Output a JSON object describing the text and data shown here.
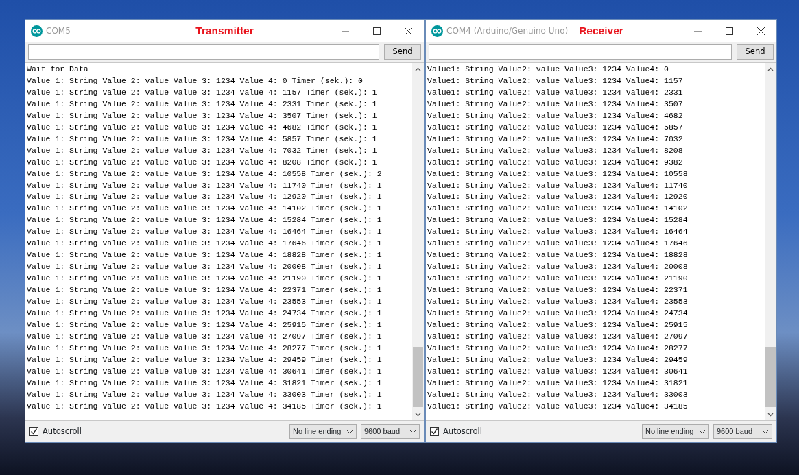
{
  "windows": [
    {
      "title": "COM5",
      "caption": "Transmitter",
      "send_label": "Send",
      "autoscroll": {
        "label": "Autoscroll",
        "checked": true
      },
      "line_ending": "No line ending",
      "baud": "9600 baud",
      "lines": [
        "Wait for Data",
        "Value 1: String Value 2: value Value 3: 1234 Value 4: 0 Timer (sek.): 0",
        "Value 1: String Value 2: value Value 3: 1234 Value 4: 1157 Timer (sek.): 1",
        "Value 1: String Value 2: value Value 3: 1234 Value 4: 2331 Timer (sek.): 1",
        "Value 1: String Value 2: value Value 3: 1234 Value 4: 3507 Timer (sek.): 1",
        "Value 1: String Value 2: value Value 3: 1234 Value 4: 4682 Timer (sek.): 1",
        "Value 1: String Value 2: value Value 3: 1234 Value 4: 5857 Timer (sek.): 1",
        "Value 1: String Value 2: value Value 3: 1234 Value 4: 7032 Timer (sek.): 1",
        "Value 1: String Value 2: value Value 3: 1234 Value 4: 8208 Timer (sek.): 1",
        "Value 1: String Value 2: value Value 3: 1234 Value 4: 10558 Timer (sek.): 2",
        "Value 1: String Value 2: value Value 3: 1234 Value 4: 11740 Timer (sek.): 1",
        "Value 1: String Value 2: value Value 3: 1234 Value 4: 12920 Timer (sek.): 1",
        "Value 1: String Value 2: value Value 3: 1234 Value 4: 14102 Timer (sek.): 1",
        "Value 1: String Value 2: value Value 3: 1234 Value 4: 15284 Timer (sek.): 1",
        "Value 1: String Value 2: value Value 3: 1234 Value 4: 16464 Timer (sek.): 1",
        "Value 1: String Value 2: value Value 3: 1234 Value 4: 17646 Timer (sek.): 1",
        "Value 1: String Value 2: value Value 3: 1234 Value 4: 18828 Timer (sek.): 1",
        "Value 1: String Value 2: value Value 3: 1234 Value 4: 20008 Timer (sek.): 1",
        "Value 1: String Value 2: value Value 3: 1234 Value 4: 21190 Timer (sek.): 1",
        "Value 1: String Value 2: value Value 3: 1234 Value 4: 22371 Timer (sek.): 1",
        "Value 1: String Value 2: value Value 3: 1234 Value 4: 23553 Timer (sek.): 1",
        "Value 1: String Value 2: value Value 3: 1234 Value 4: 24734 Timer (sek.): 1",
        "Value 1: String Value 2: value Value 3: 1234 Value 4: 25915 Timer (sek.): 1",
        "Value 1: String Value 2: value Value 3: 1234 Value 4: 27097 Timer (sek.): 1",
        "Value 1: String Value 2: value Value 3: 1234 Value 4: 28277 Timer (sek.): 1",
        "Value 1: String Value 2: value Value 3: 1234 Value 4: 29459 Timer (sek.): 1",
        "Value 1: String Value 2: value Value 3: 1234 Value 4: 30641 Timer (sek.): 1",
        "Value 1: String Value 2: value Value 3: 1234 Value 4: 31821 Timer (sek.): 1",
        "Value 1: String Value 2: value Value 3: 1234 Value 4: 33003 Timer (sek.): 1",
        "Value 1: String Value 2: value Value 3: 1234 Value 4: 34185 Timer (sek.): 1"
      ]
    },
    {
      "title": "COM4 (Arduino/Genuino Uno)",
      "caption": "Receiver",
      "send_label": "Send",
      "autoscroll": {
        "label": "Autoscroll",
        "checked": true
      },
      "line_ending": "No line ending",
      "baud": "9600 baud",
      "lines": [
        "Value1: String Value2: value Value3: 1234 Value4: 0",
        "Value1: String Value2: value Value3: 1234 Value4: 1157",
        "Value1: String Value2: value Value3: 1234 Value4: 2331",
        "Value1: String Value2: value Value3: 1234 Value4: 3507",
        "Value1: String Value2: value Value3: 1234 Value4: 4682",
        "Value1: String Value2: value Value3: 1234 Value4: 5857",
        "Value1: String Value2: value Value3: 1234 Value4: 7032",
        "Value1: String Value2: value Value3: 1234 Value4: 8208",
        "Value1: String Value2: value Value3: 1234 Value4: 9382",
        "Value1: String Value2: value Value3: 1234 Value4: 10558",
        "Value1: String Value2: value Value3: 1234 Value4: 11740",
        "Value1: String Value2: value Value3: 1234 Value4: 12920",
        "Value1: String Value2: value Value3: 1234 Value4: 14102",
        "Value1: String Value2: value Value3: 1234 Value4: 15284",
        "Value1: String Value2: value Value3: 1234 Value4: 16464",
        "Value1: String Value2: value Value3: 1234 Value4: 17646",
        "Value1: String Value2: value Value3: 1234 Value4: 18828",
        "Value1: String Value2: value Value3: 1234 Value4: 20008",
        "Value1: String Value2: value Value3: 1234 Value4: 21190",
        "Value1: String Value2: value Value3: 1234 Value4: 22371",
        "Value1: String Value2: value Value3: 1234 Value4: 23553",
        "Value1: String Value2: value Value3: 1234 Value4: 24734",
        "Value1: String Value2: value Value3: 1234 Value4: 25915",
        "Value1: String Value2: value Value3: 1234 Value4: 27097",
        "Value1: String Value2: value Value3: 1234 Value4: 28277",
        "Value1: String Value2: value Value3: 1234 Value4: 29459",
        "Value1: String Value2: value Value3: 1234 Value4: 30641",
        "Value1: String Value2: value Value3: 1234 Value4: 31821",
        "Value1: String Value2: value Value3: 1234 Value4: 33003",
        "Value1: String Value2: value Value3: 1234 Value4: 34185"
      ]
    }
  ]
}
